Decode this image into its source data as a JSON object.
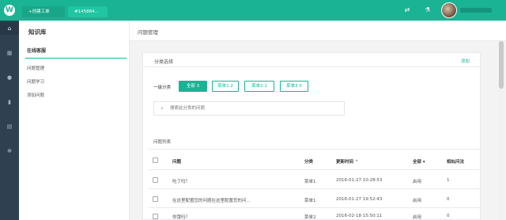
{
  "topbar": {
    "logo_glyph": "W",
    "tabs": [
      "+创建工单",
      "#145884..."
    ],
    "icons": [
      "refresh-icon",
      "flask-icon"
    ],
    "accent": "#1ab394"
  },
  "rail": {
    "icons": [
      "home-icon",
      "grid-icon",
      "user-icon",
      "bar-chart-icon",
      "book-icon",
      "settings-icon"
    ]
  },
  "sidebar": {
    "title": "知识库",
    "section": "在线客服",
    "items": [
      "问题管理",
      "问题学习",
      "添加问题"
    ]
  },
  "main": {
    "title": "问题管理"
  },
  "category": {
    "header": "分类选择",
    "add_link": "添加",
    "label": "一级分类",
    "buttons": [
      "全部 3",
      "菜单1 2",
      "菜单2 1",
      "菜单3 0"
    ],
    "active_index": 0
  },
  "search": {
    "placeholder": "搜索此分类的问题"
  },
  "list": {
    "title": "问题列表",
    "columns": {
      "question": "问题",
      "category": "分类",
      "updated": "更新时间 ⌃",
      "filter": "全部 ▾",
      "similar": "相似问法"
    },
    "rows": [
      {
        "question": "吃了吗？",
        "category": "菜单1",
        "updated": "2016-01-27 10:28:53",
        "status": "启用",
        "similar": "1"
      },
      {
        "question": "在这里配置您的问题在这里配置您的问...",
        "category": "菜单1",
        "updated": "2016-01-27 19:52:43",
        "status": "启用",
        "similar": "0"
      },
      {
        "question": "你饿吗？",
        "category": "菜单2",
        "updated": "2016-02-18 15:50:11",
        "status": "启用",
        "similar": "0"
      }
    ]
  }
}
